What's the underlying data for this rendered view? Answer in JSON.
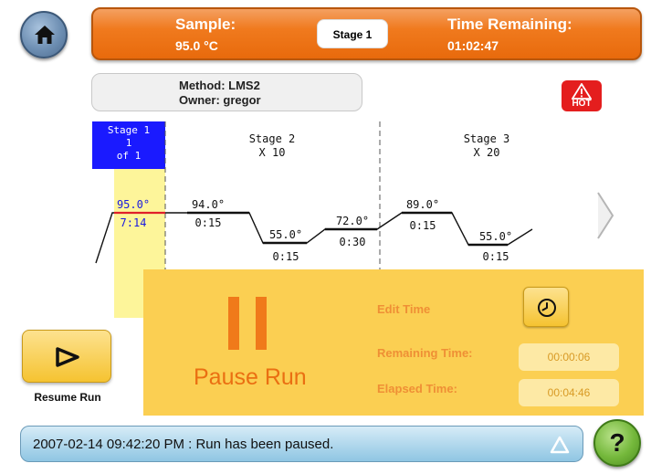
{
  "header": {
    "sample_label": "Sample:",
    "sample_value": "95.0 °C",
    "stage_button": "Stage 1",
    "time_label": "Time Remaining:",
    "time_value": "01:02:47"
  },
  "method": {
    "method": "Method: LMS2",
    "owner": "Owner: gregor"
  },
  "hot_badge": {
    "label": "HOT",
    "icon": "warning-triangle-icon",
    "color": "#e41e1e"
  },
  "profile": {
    "stages": [
      {
        "title": "Stage 1",
        "line2": "1",
        "line3": "of 1",
        "active": true
      },
      {
        "title": "Stage 2",
        "line2": "X 10"
      },
      {
        "title": "Stage 3",
        "line2": "X 20"
      }
    ],
    "steps": [
      {
        "temp": "95.0°",
        "time": "7:14",
        "active": true
      },
      {
        "temp": "94.0°",
        "time": "0:15"
      },
      {
        "temp": "55.0°",
        "time": "0:15"
      },
      {
        "temp": "72.0°",
        "time": "0:30"
      },
      {
        "temp": "89.0°",
        "time": "0:15"
      },
      {
        "temp": "55.0°",
        "time": "0:15"
      }
    ],
    "next_arrow_icon": "chevron-right-icon"
  },
  "resume": {
    "label": "Resume Run",
    "icon": "play-outline-icon"
  },
  "pause_panel": {
    "title": "Pause Run",
    "edit_time_label": "Edit Time",
    "remaining_label": "Remaining Time:",
    "remaining_value": "00:00:06",
    "elapsed_label": "Elapsed Time:",
    "elapsed_value": "00:04:46",
    "clock_icon": "clock-icon"
  },
  "message_bar": {
    "text": "2007-02-14 09:42:20 PM : Run has been paused.",
    "expand_icon": "triangle-up-icon"
  },
  "help": {
    "label": "?"
  },
  "colors": {
    "accent_orange": "#f07a1e",
    "panel_yellow": "#fbcf52",
    "active_stage_blue": "#1a1aff",
    "active_step_highlight": "#fdf59a"
  }
}
